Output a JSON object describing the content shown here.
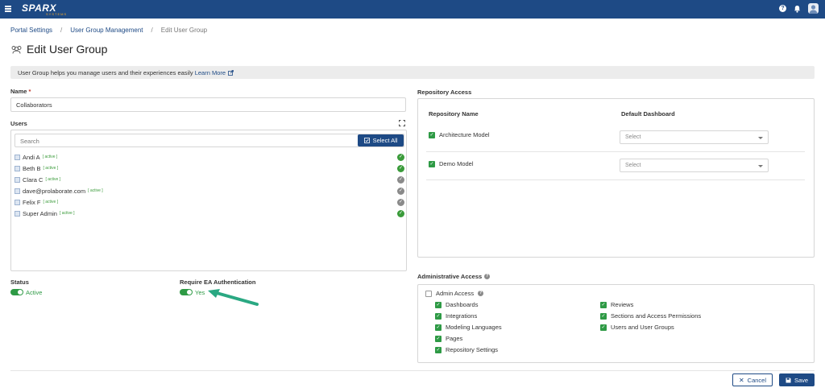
{
  "header": {
    "logo_text": "SPARX",
    "logo_sub": "SYSTEMS",
    "help_glyph": "?"
  },
  "breadcrumb": {
    "items": [
      "Portal Settings",
      "User Group Management",
      "Edit User Group"
    ],
    "separator": "/"
  },
  "page": {
    "title": "Edit User Group"
  },
  "banner": {
    "text": "User Group helps you manage users and their experiences easily ",
    "link": "Learn More"
  },
  "form": {
    "name_label": "Name",
    "name_required": "*",
    "name_value": "Collaborators",
    "users_label": "Users",
    "search_placeholder": "Search",
    "select_all_label": "Select All",
    "users": [
      {
        "name": "Andi A",
        "status": "[ active ]",
        "selected": true
      },
      {
        "name": "Beth B",
        "status": "[ active ]",
        "selected": true
      },
      {
        "name": "Clara C",
        "status": "[ active ]",
        "selected": false
      },
      {
        "name": "dave@prolaborate.com",
        "status": "[ active ]",
        "selected": false
      },
      {
        "name": "Felix F",
        "status": "[ active ]",
        "selected": false
      },
      {
        "name": "Super Admin",
        "status": "[ active ]",
        "selected": true
      }
    ],
    "status_label": "Status",
    "status_value": "Active",
    "ea_auth_label": "Require EA Authentication",
    "ea_auth_value": "Yes"
  },
  "repository": {
    "section_label": "Repository Access",
    "col_name": "Repository Name",
    "col_dashboard": "Default Dashboard",
    "rows": [
      {
        "name": "Architecture Model",
        "checked": true,
        "dashboard_placeholder": "Select"
      },
      {
        "name": "Demo Model",
        "checked": true,
        "dashboard_placeholder": "Select"
      }
    ]
  },
  "admin": {
    "section_label": "Administrative Access",
    "admin_access_label": "Admin Access",
    "admin_access_checked": false,
    "left_perms": [
      "Dashboards",
      "Integrations",
      "Modeling Languages",
      "Pages",
      "Repository Settings"
    ],
    "right_perms": [
      "Reviews",
      "Sections and Access Permissions",
      "Users and User Groups"
    ]
  },
  "footer": {
    "cancel_label": "Cancel",
    "save_label": "Save"
  },
  "colors": {
    "brand": "#1e4a85",
    "success": "#2e9a45",
    "muted": "#8a8a8a",
    "arrow": "#2aa882"
  }
}
